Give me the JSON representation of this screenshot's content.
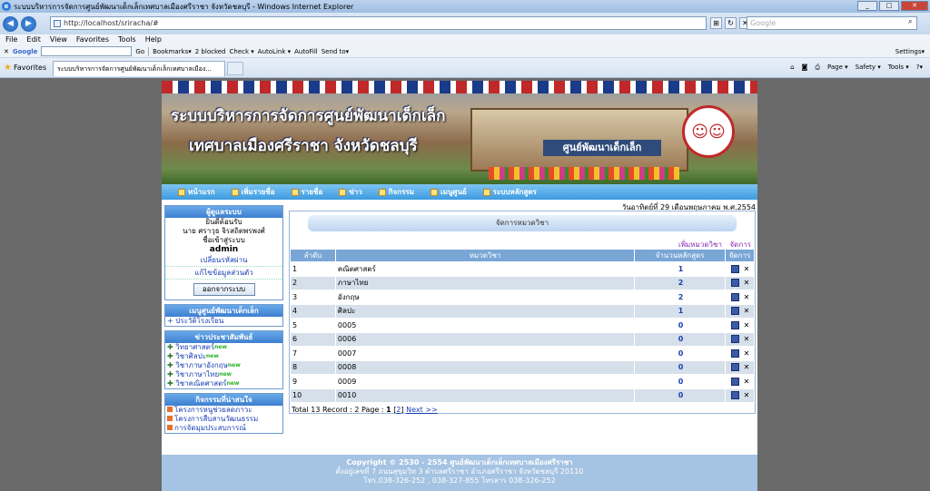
{
  "window": {
    "title": "ระบบบริหารการจัดการศูนย์พัฒนาเด็กเล็กเทศบาลเมืองศรีราชา จังหวัดชลบุรี - Windows Internet Explorer",
    "min": "_",
    "max": "□",
    "close": "✕"
  },
  "address": {
    "url": "http://localhost/sriracha/#",
    "search_placeholder": "Google"
  },
  "menu": [
    "File",
    "Edit",
    "View",
    "Favorites",
    "Tools",
    "Help"
  ],
  "toolbar": {
    "google": "Google",
    "go": "Go",
    "bookmarks": "Bookmarks▾",
    "blocked": "2 blocked",
    "check": "Check ▾",
    "autolink": "AutoLink ▾",
    "autofill": "AutoFill",
    "sendto": "Send to▾",
    "settings": "Settings▾"
  },
  "favbar": {
    "favorites": "Favorites",
    "tab": "ระบบบริหารการจัดการศูนย์พัฒนาเด็กเล็กเทศบาลเมือง...",
    "page": "Page ▾",
    "safety": "Safety ▾",
    "tools": "Tools ▾",
    "help": "?▾"
  },
  "banner": {
    "line1": "ระบบบริหารการจัดการศูนย์พัฒนาเด็กเล็ก",
    "line2": "เทศบาลเมืองศรีราชา จังหวัดชลบุรี",
    "sign": "ศูนย์พัฒนาเด็กเล็ก"
  },
  "nav": [
    "หน้าแรก",
    "เพิ่มรายชื่อ",
    "รายชื่อ",
    "ข่าว",
    "กิจกรรม",
    "เมนูศูนย์",
    "ระบบหลักสูตร"
  ],
  "date": "วันอาทิตย์ที่ 29 เดือนพฤษภาคม พ.ศ.2554",
  "user": {
    "header": "ผู้ดูแลระบบ",
    "welcome": "ยินดีต้อนรับ",
    "name": "นาย ศราวุธ จิรสถิตพรพงศ์",
    "login_as": "ชื่อเข้าสู่ระบบ",
    "username": "admin",
    "change_pw": "เปลี่ยนรหัสผ่าน",
    "edit_profile": "แก้ไขข้อมูลส่วนตัว",
    "logout": "ออกจากระบบ"
  },
  "menu_center": {
    "header": "เมนูศูนย์พัฒนาเด็กเล็ก",
    "items": [
      "ประวัติโรงเรียน"
    ]
  },
  "news": {
    "header": "ข่าวประชาสัมพันธ์",
    "badge": "new",
    "items": [
      "วิทยาศาสตร์",
      "วิชาศิลปะ",
      "วิชาภาษาอังกฤษ",
      "วิชาภาษาไทย",
      "วิชาคณิตศาสตร์"
    ]
  },
  "activities": {
    "header": "กิจกรรมที่น่าสนใจ",
    "items": [
      "โครงการหนูช่วยลดภาวะ",
      "โครงการสืบสานวัฒนธรรม",
      "การจัดมุมประสบการณ์"
    ]
  },
  "main": {
    "title": "จัดการหมวดวิชา",
    "add": "เพิ่มหมวดวิชา",
    "manage": "จัดการ",
    "columns": [
      "ลำดับ",
      "หมวดวิชา",
      "จำนวนหลักสูตร",
      "จัดการ"
    ],
    "rows": [
      {
        "no": "1",
        "name": "คณิตศาสตร์",
        "count": "1"
      },
      {
        "no": "2",
        "name": "ภาษาไทย",
        "count": "2"
      },
      {
        "no": "3",
        "name": "อังกฤษ",
        "count": "2"
      },
      {
        "no": "4",
        "name": "ศิลปะ",
        "count": "1"
      },
      {
        "no": "5",
        "name": "0005",
        "count": "0"
      },
      {
        "no": "6",
        "name": "0006",
        "count": "0"
      },
      {
        "no": "7",
        "name": "0007",
        "count": "0"
      },
      {
        "no": "8",
        "name": "0008",
        "count": "0"
      },
      {
        "no": "9",
        "name": "0009",
        "count": "0"
      },
      {
        "no": "10",
        "name": "0010",
        "count": "0"
      }
    ],
    "pager": {
      "summary": "Total 13 Record : 2 Page :",
      "current": "1",
      "bracket_open": "[",
      "page2": "2",
      "bracket_close": "]",
      "next": "Next >>"
    }
  },
  "footer": {
    "line1": "Copyright © 2530 - 2554 ศูนย์พัฒนาเด็กเล็กเทศบาลเมืองศรีราชา",
    "line2": "ตั้งอยู่เลขที่ 7 ถนนสุขุมวิท 3 ตำบลศรีราชา อำเภอศรีราชา จังหวัดชลบุรี 20110",
    "line3": "โทร.038-326-252 , 038-327-855 โทรสาร 038-326-252"
  }
}
